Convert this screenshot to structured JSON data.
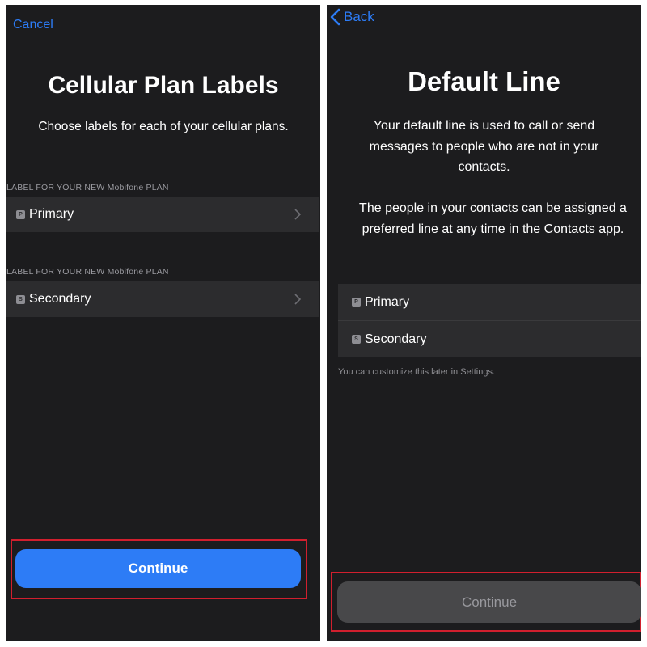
{
  "left": {
    "cancel_label": "Cancel",
    "title": "Cellular Plan Labels",
    "subtitle": "Choose labels for each of your cellular plans.",
    "sections": [
      {
        "header": "LABEL FOR YOUR NEW Mobifone PLAN",
        "row_label": "Primary",
        "icon_letter": "P"
      },
      {
        "header": "LABEL FOR YOUR NEW Mobifone PLAN",
        "row_label": "Secondary",
        "icon_letter": "S"
      }
    ],
    "continue_label": "Continue"
  },
  "right": {
    "back_label": "Back",
    "title": "Default Line",
    "paragraph_1": "Your default line is used to call or send messages to people who are not in your contacts.",
    "paragraph_2": "The people in your contacts can be assigned a preferred line at any time in the Contacts app.",
    "options": [
      {
        "label": "Primary",
        "icon_letter": "P"
      },
      {
        "label": "Secondary",
        "icon_letter": "S"
      }
    ],
    "footnote": "You can customize this later in Settings.",
    "continue_label": "Continue"
  },
  "colors": {
    "accent_blue": "#2d7cf6",
    "highlight_red": "#d11f2e",
    "screen_bg": "#1c1c1e",
    "row_bg": "#2c2c2e"
  },
  "icons": [
    "back-chevron-icon",
    "disclosure-chevron-icon",
    "sim-label-icon"
  ]
}
